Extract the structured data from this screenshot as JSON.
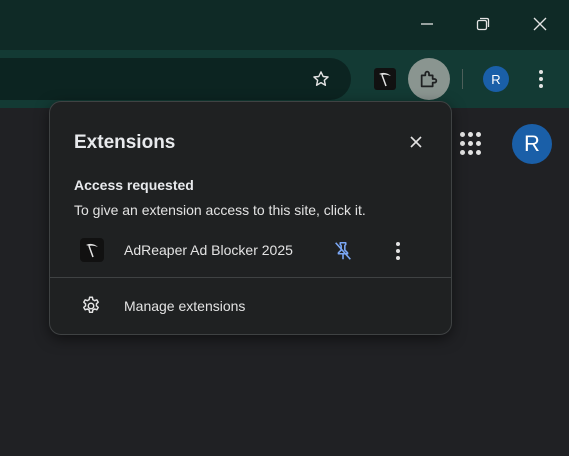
{
  "window_controls": {
    "minimize_icon": "minimize-icon",
    "restore_icon": "restore-icon",
    "close_icon": "close-icon"
  },
  "toolbar": {
    "bookmark_icon": "star-icon",
    "extension_icon": "adreaper-scythe-icon",
    "extensions_button_icon": "puzzle-icon",
    "profile_initial": "R"
  },
  "page": {
    "apps_icon": "apps-grid-icon",
    "profile_initial": "R"
  },
  "popup": {
    "title": "Extensions",
    "close_icon": "close-icon",
    "section_heading": "Access requested",
    "section_description": "To give an extension access to this site, click it.",
    "extension": {
      "name": "AdReaper Ad Blocker 2025",
      "pin_state": "unpinned",
      "pin_icon": "unpin-icon",
      "menu_icon": "more-vert-icon"
    },
    "manage_label": "Manage extensions",
    "manage_icon": "gear-icon"
  },
  "colors": {
    "titlebar": "#0f2a26",
    "toolbar": "#133a34",
    "page_background": "#202124",
    "popup_background": "#1f2122",
    "accent_blue": "#1a5fa8",
    "pin_blue": "#7ba7f5"
  }
}
